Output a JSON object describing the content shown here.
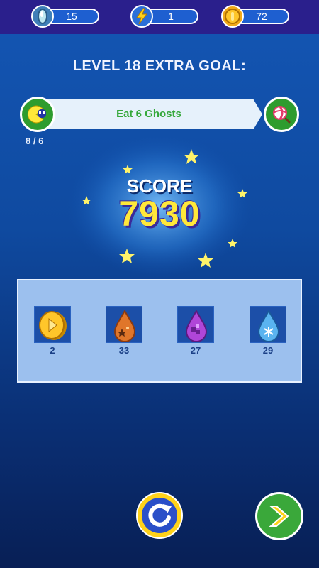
{
  "resources": {
    "gems": {
      "value": "15",
      "icon": "gem-icon"
    },
    "energy": {
      "value": "1",
      "icon": "lightning-icon"
    },
    "coins": {
      "value": "72",
      "icon": "coin-icon"
    }
  },
  "goal": {
    "title": "LEVEL 18 EXTRA GOAL:",
    "description": "Eat 6 Ghosts",
    "progress": "8 / 6",
    "left_icon": "ghost-eater-icon",
    "right_icon": "lollipop-icon"
  },
  "score": {
    "label": "SCORE",
    "value": "7930"
  },
  "rewards": [
    {
      "icon": "coin-icon",
      "count": "2"
    },
    {
      "icon": "orange-drop-icon",
      "count": "33"
    },
    {
      "icon": "purple-drop-icon",
      "count": "27"
    },
    {
      "icon": "ice-drop-icon",
      "count": "29"
    }
  ],
  "buttons": {
    "restart_icon": "restart-icon",
    "next_icon": "next-arrow-icon"
  },
  "colors": {
    "topbar": "#2a1f8c",
    "accent_green": "#2e9c2e",
    "score_yellow": "#ffe83a",
    "panel": "#9cc0ee"
  }
}
